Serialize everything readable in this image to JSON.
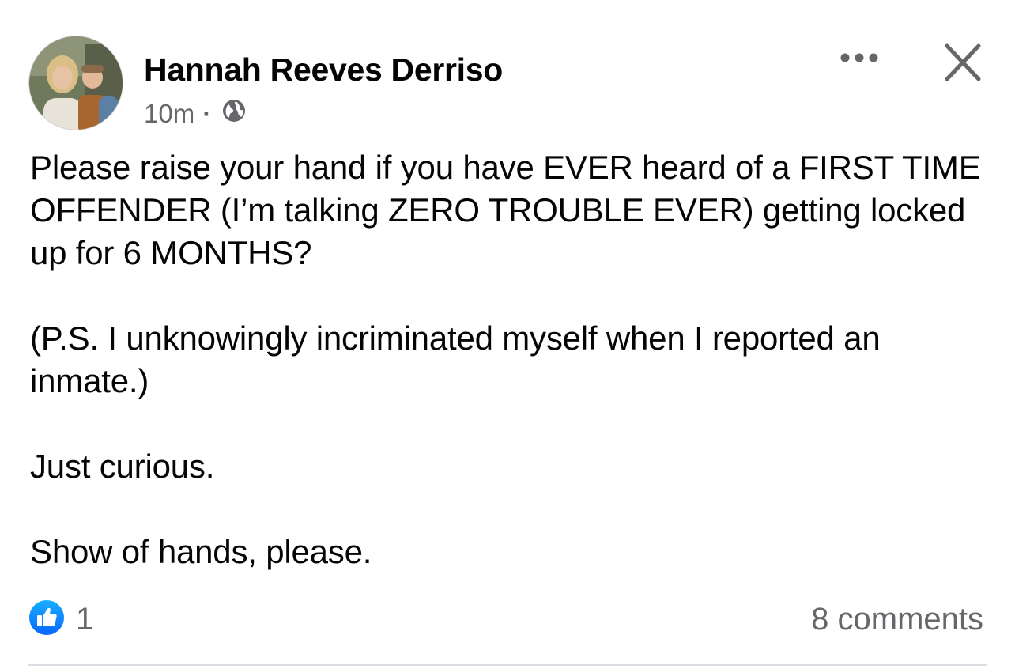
{
  "post": {
    "author": "Hannah Reeves Derriso",
    "time": "10m",
    "separator": "·",
    "audience_icon": "globe-icon",
    "paragraphs": [
      "Please raise your hand if you have EVER heard of a FIRST TIME OFFENDER (I’m talking ZERO TROUBLE EVER) getting locked up for 6 MONTHS?",
      "(P.S. I unknowingly incriminated myself when I reported an inmate.)",
      "Just curious.",
      "Show of hands, please."
    ]
  },
  "footer": {
    "reaction_icon": "like-icon",
    "reaction_count": "1",
    "comments": "8 comments"
  },
  "icons": {
    "more": "more-options-icon",
    "close": "close-icon"
  },
  "colors": {
    "text": "#050505",
    "secondary": "#65676b",
    "like_blue": "#1877f2",
    "divider": "#dadde1"
  }
}
